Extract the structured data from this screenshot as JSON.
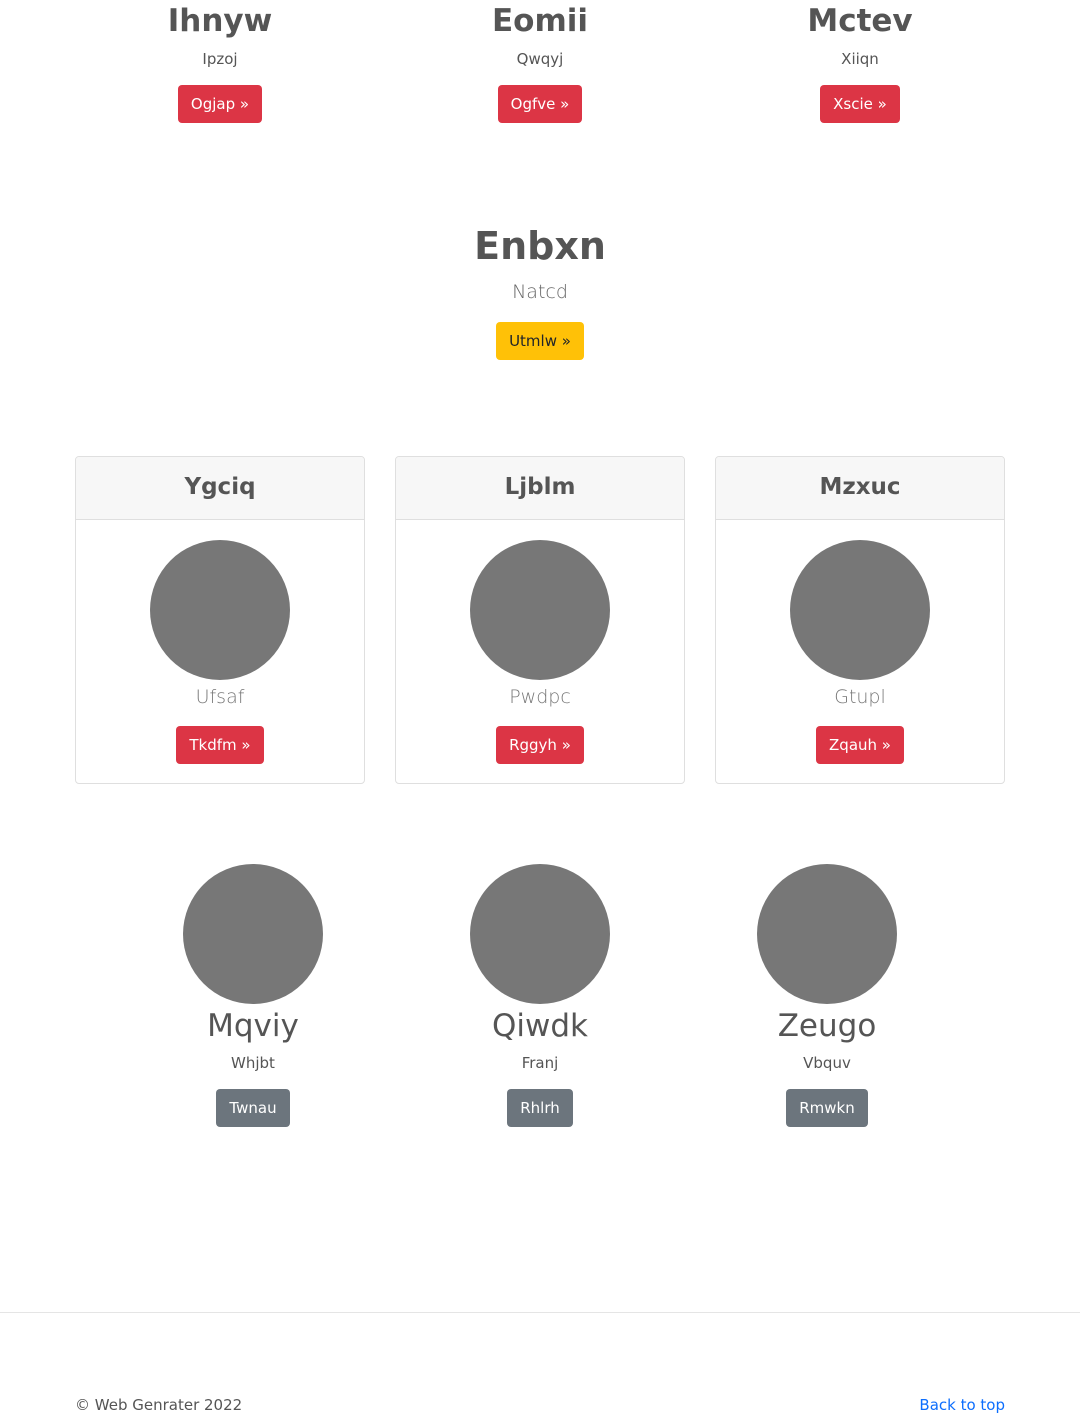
{
  "top_items": [
    {
      "title": "Ihnyw",
      "subtitle": "Ipzoj",
      "button": "Ogjap »"
    },
    {
      "title": "Eomii",
      "subtitle": "Qwqyj",
      "button": "Ogfve »"
    },
    {
      "title": "Mctev",
      "subtitle": "Xiiqn",
      "button": "Xscie »"
    }
  ],
  "hero": {
    "title": "Enbxn",
    "subtitle": "Natcd",
    "button": "Utmlw »"
  },
  "cards": [
    {
      "header": "Ygciq",
      "caption": "Ufsaf",
      "button": "Tkdfm »"
    },
    {
      "header": "Ljblm",
      "caption": "Pwdpc",
      "button": "Rggyh »"
    },
    {
      "header": "Mzxuc",
      "caption": "Gtupl",
      "button": "Zqauh »"
    }
  ],
  "people": [
    {
      "name": "Mqviy",
      "subtitle": "Whjbt",
      "button": "Twnau"
    },
    {
      "name": "Qiwdk",
      "subtitle": "Franj",
      "button": "Rhlrh"
    },
    {
      "name": "Zeugo",
      "subtitle": "Vbquv",
      "button": "Rmwkn"
    }
  ],
  "footer": {
    "copyright": "© Web Genrater 2022",
    "back_to_top": "Back to top"
  },
  "colors": {
    "danger": "#dc3545",
    "warning": "#ffc107",
    "secondary": "#6c757d",
    "placeholder": "#777777",
    "link": "#0d6efd"
  }
}
